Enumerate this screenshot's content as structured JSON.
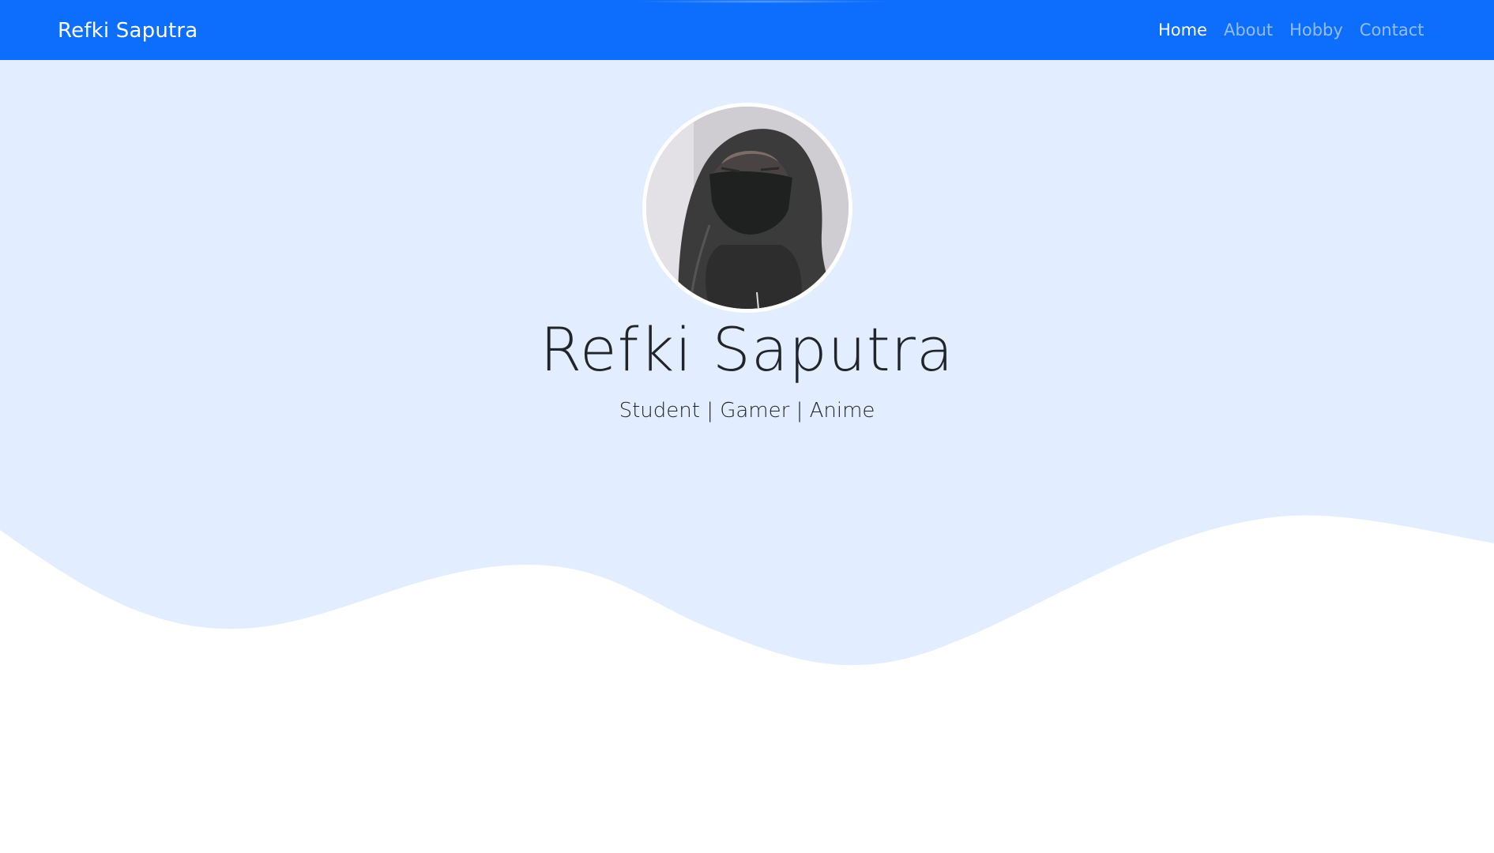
{
  "navbar": {
    "brand": "Refki Saputra",
    "links": [
      {
        "label": "Home",
        "active": true
      },
      {
        "label": "About",
        "active": false
      },
      {
        "label": "Hobby",
        "active": false
      },
      {
        "label": "Contact",
        "active": false
      }
    ]
  },
  "hero": {
    "name": "Refki Saputra",
    "tagline": "Student | Gamer | Anime",
    "avatar_icon": "profile-photo"
  },
  "colors": {
    "navbar_bg": "#0d6efd",
    "hero_bg": "#e2edff",
    "text": "#212529",
    "page_bg": "#ffffff"
  }
}
